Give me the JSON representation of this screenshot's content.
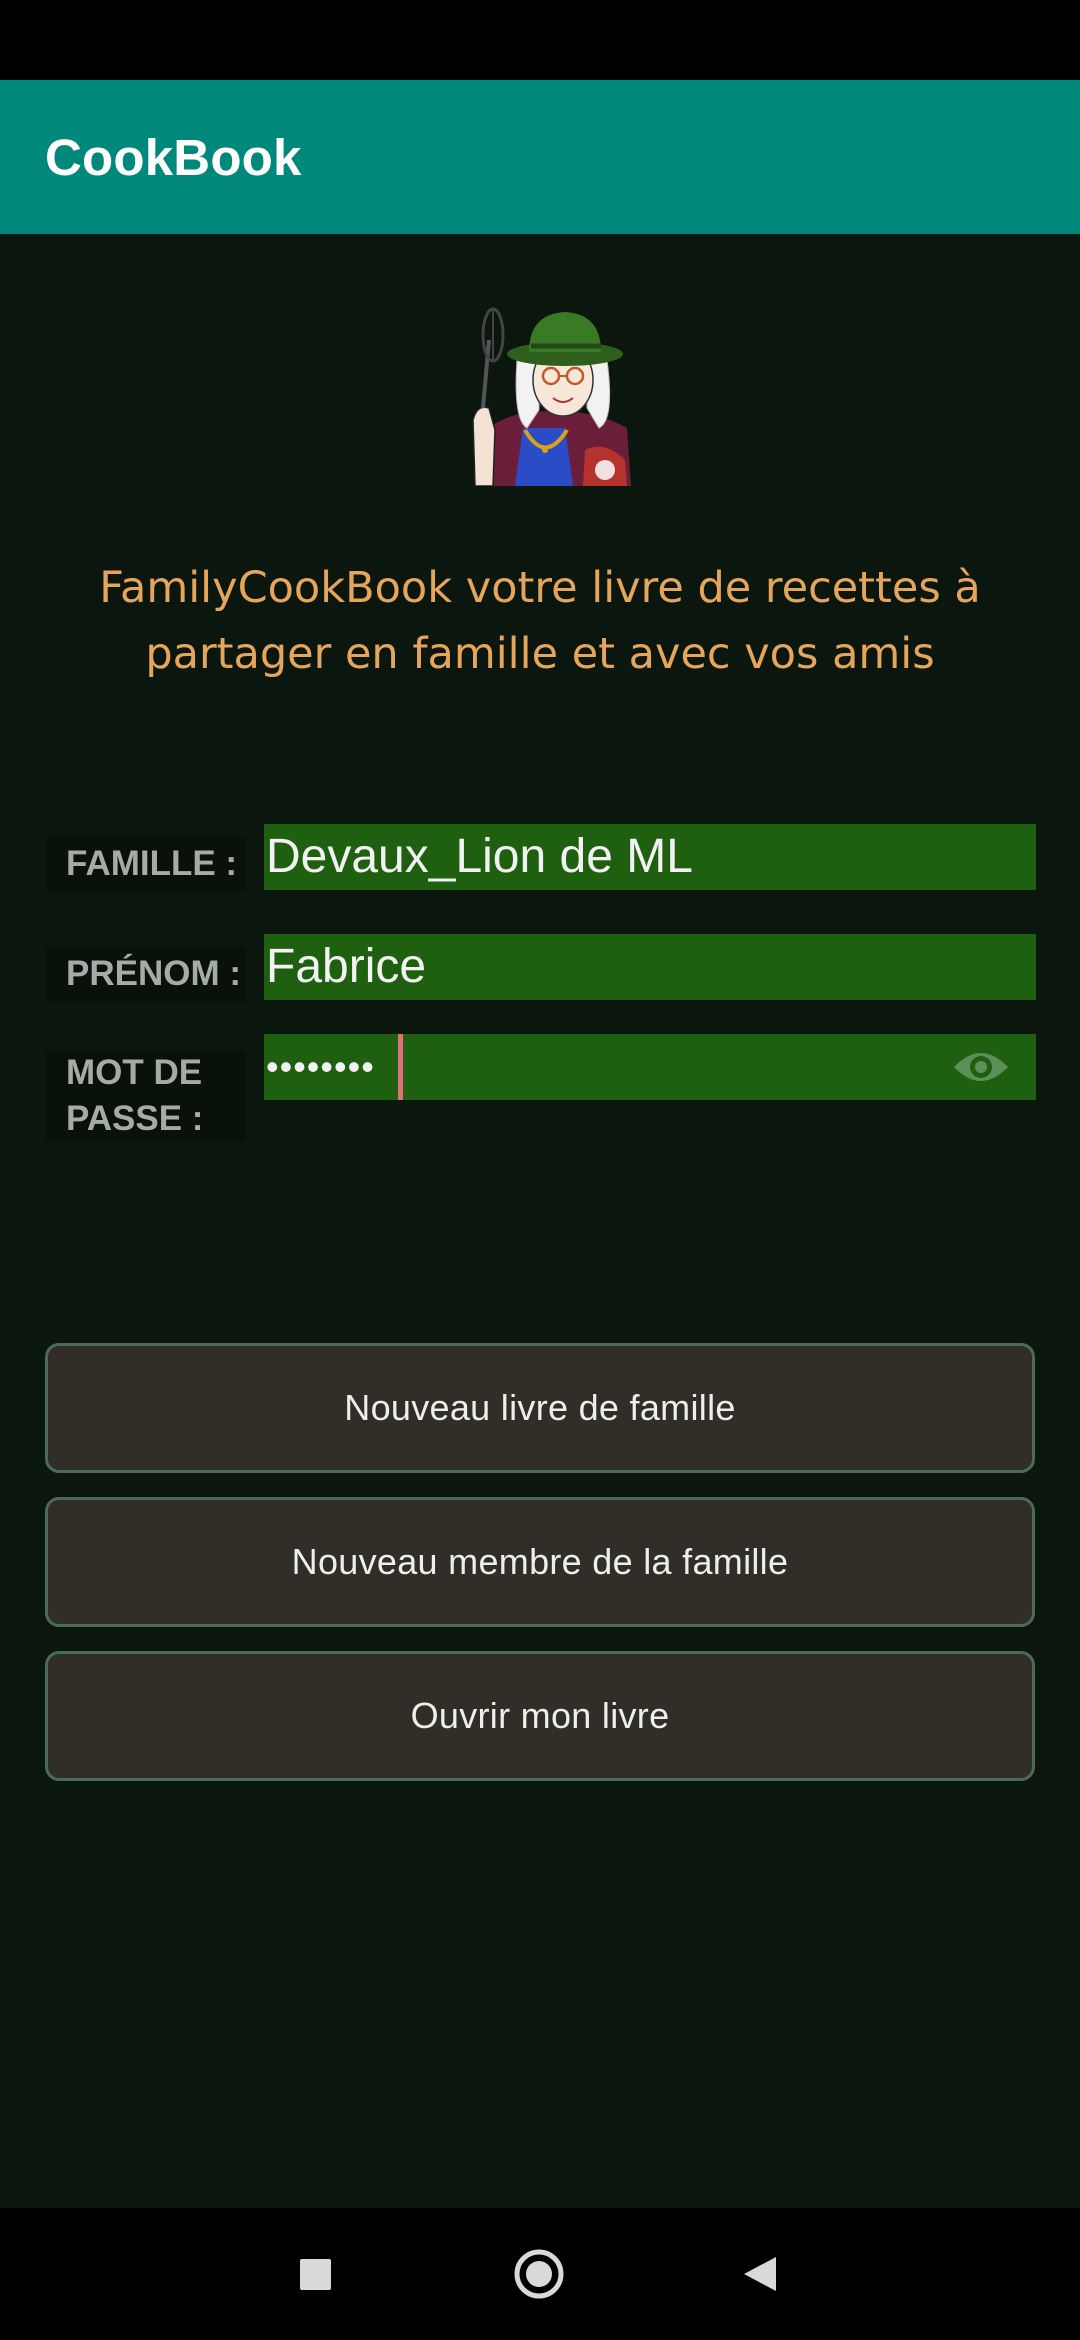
{
  "app_bar": {
    "title": "CookBook",
    "color": "#00897b"
  },
  "mascot": {
    "icon": "grandma-chef-with-whisk-icon"
  },
  "tagline": {
    "line1": "FamilyCookBook votre livre de recettes à",
    "line2": "partager en famille et avec vos amis"
  },
  "form": {
    "famille_label": "FAMILLE :",
    "famille_value": "Devaux_Lion de ML",
    "prenom_label": "PRÉNOM :",
    "prenom_value": "Fabrice",
    "password_label_line1": "MOT DE",
    "password_label_line2": "PASSE :",
    "password_masked": "••••••••",
    "password_toggle_icon": "eye-icon",
    "field_color": "#1f5f10"
  },
  "buttons": {
    "new_book": "Nouveau livre de famille",
    "new_member": "Nouveau membre de la famille",
    "open_book": "Ouvrir mon livre"
  },
  "navigation": {
    "recents_icon": "square-recents-icon",
    "home_icon": "circle-home-icon",
    "back_icon": "triangle-back-icon"
  }
}
